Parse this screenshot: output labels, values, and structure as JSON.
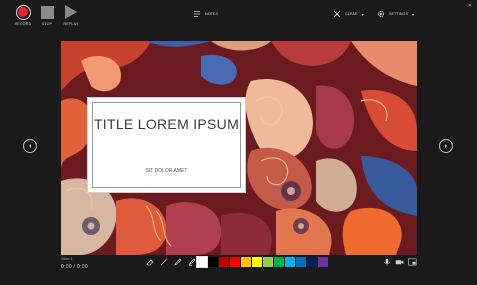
{
  "toolbar": {
    "record_label": "RECORD",
    "stop_label": "STOP",
    "replay_label": "REPLAY",
    "notes_label": "NOTES",
    "clear_label": "CLEAR",
    "settings_label": "SETTINGS",
    "close_label": "✕"
  },
  "slide": {
    "title": "TITLE LOREM IPSUM",
    "subtitle": "SIT DOLOR AMET"
  },
  "status": {
    "slide_number": "Slide 1",
    "timer": "0:00 / 0:00"
  },
  "colors": {
    "record": "#e3262b",
    "swatches": [
      "#ffffff",
      "#000000",
      "#c00000",
      "#ff0000",
      "#ffc000",
      "#ffff00",
      "#92d050",
      "#00b050",
      "#00b0f0",
      "#0070c0",
      "#002060",
      "#7030a0"
    ]
  },
  "icons": {
    "tools": [
      "eraser-icon",
      "laser-pointer-icon",
      "pen-icon",
      "highlighter-icon"
    ],
    "right": [
      "microphone-icon",
      "camera-icon",
      "camera-preview-icon"
    ]
  }
}
